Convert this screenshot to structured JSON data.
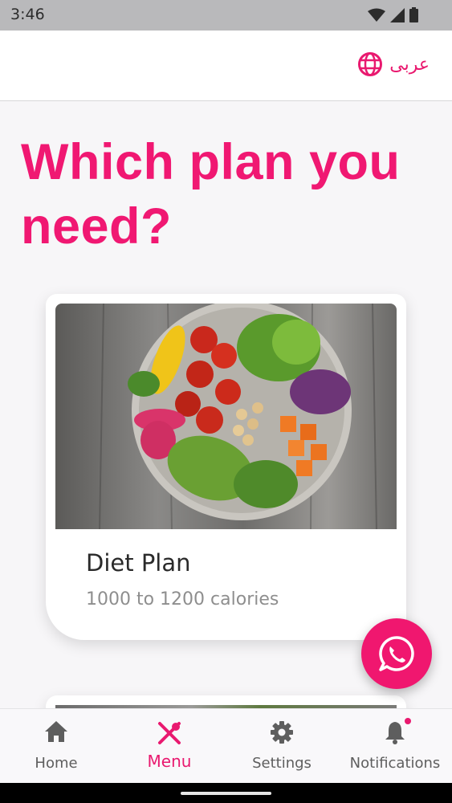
{
  "status_bar": {
    "time": "3:46",
    "icons": [
      "wifi-icon",
      "signal-icon",
      "battery-icon"
    ]
  },
  "app_bar": {
    "language_label": "عربى",
    "language_icon": "globe-icon"
  },
  "page": {
    "title": "Which plan you need?"
  },
  "plans": [
    {
      "title": "Diet Plan",
      "subtitle": "1000 to 1200 calories",
      "image": "salad-bowl-photo"
    }
  ],
  "fab": {
    "icon": "whatsapp-icon"
  },
  "bottom_nav": {
    "items": [
      {
        "label": "Home",
        "icon": "home-icon"
      },
      {
        "label": "Menu",
        "icon": "fork-knife-icon",
        "active": true
      },
      {
        "label": "Settings",
        "icon": "gear-icon"
      },
      {
        "label": "Notifications",
        "icon": "bell-icon",
        "badge": true
      }
    ]
  },
  "colors": {
    "accent": "#e9196f",
    "title": "#f01872",
    "background": "#f7f6f8"
  }
}
